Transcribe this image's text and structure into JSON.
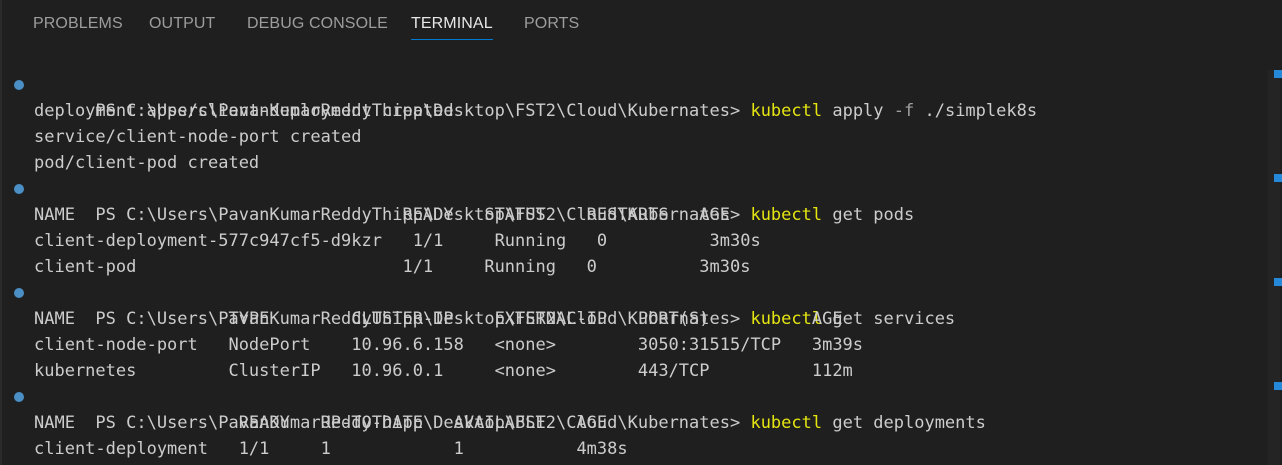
{
  "tabs": [
    {
      "label": "PROBLEMS",
      "active": false
    },
    {
      "label": "OUTPUT",
      "active": false
    },
    {
      "label": "DEBUG CONSOLE",
      "active": false
    },
    {
      "label": "TERMINAL",
      "active": true
    },
    {
      "label": "PORTS",
      "active": false
    }
  ],
  "terminal": {
    "prompt": "PS C:\\Users\\PavanKumarReddyThipp\\Desktop\\FST2\\Cloud\\Kubernates> ",
    "blocks": [
      {
        "command": {
          "name": "kubectl",
          "args_before_flag": " apply ",
          "flag": "-f",
          "args_after_flag": " ./simplek8s"
        },
        "output": [
          "deployment.apps/client-deployment created",
          "service/client-node-port created",
          "pod/client-pod created"
        ]
      },
      {
        "command": {
          "name": "kubectl",
          "args": " get pods"
        },
        "output": [
          "NAME                                READY   STATUS    RESTARTS   AGE",
          "client-deployment-577c947cf5-d9kzr   1/1     Running   0          3m30s",
          "client-pod                          1/1     Running   0          3m30s"
        ]
      },
      {
        "command": {
          "name": "kubectl",
          "args": " get services"
        },
        "output": [
          "NAME               TYPE        CLUSTER-IP    EXTERNAL-IP   PORT(S)          AGE",
          "client-node-port   NodePort    10.96.6.158   <none>        3050:31515/TCP   3m39s",
          "kubernetes         ClusterIP   10.96.0.1     <none>        443/TCP          112m"
        ]
      },
      {
        "command": {
          "name": "kubectl",
          "args": " get deployments"
        },
        "output": [
          "NAME                READY   UP-TO-DATE   AVAILABLE   AGE",
          "client-deployment   1/1     1            1           4m38s"
        ]
      }
    ]
  },
  "colors": {
    "background": "#1f1f1f",
    "text": "#cccccc",
    "command": "#e5e510",
    "flag": "#a0a0a0",
    "active_tab_underline": "#0078d4",
    "decoration_dot": "#4a8fc6"
  }
}
